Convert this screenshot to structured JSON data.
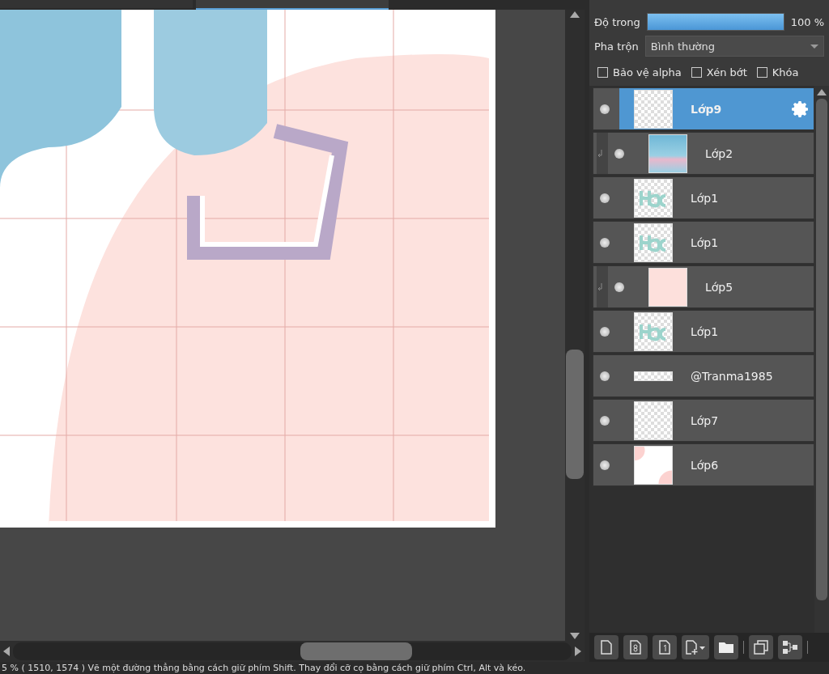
{
  "document_tabs": [
    {
      "selected": false
    },
    {
      "selected": true
    }
  ],
  "layer_panel": {
    "opacity": {
      "label": "Độ trong",
      "level": 1,
      "reading": "100 %"
    },
    "blend": {
      "label": "Pha trộn",
      "value": "Bình thường"
    },
    "options": [
      {
        "label": "Bảo vệ alpha",
        "checked": false
      },
      {
        "label": "Xén bớt",
        "checked": false
      },
      {
        "label": "Khóa",
        "checked": false
      }
    ],
    "layers": [
      {
        "name": "Lớp9",
        "kind": "normal",
        "thumbnail": {
          "kind": "transparent"
        },
        "selected": true,
        "visible": true
      },
      {
        "name": "Lớp2",
        "kind": "clipped",
        "thumbnail": {
          "kind": "blue"
        },
        "selected": false,
        "visible": true
      },
      {
        "name": "Lớp1",
        "kind": "normal",
        "thumbnail": {
          "kind": "lettering"
        },
        "selected": false,
        "visible": true
      },
      {
        "name": "Lớp1",
        "kind": "normal",
        "thumbnail": {
          "kind": "lettering"
        },
        "selected": false,
        "visible": true
      },
      {
        "name": "Lớp5",
        "kind": "clipped",
        "thumbnail": {
          "kind": "pink"
        },
        "selected": false,
        "visible": true
      },
      {
        "name": "Lớp1",
        "kind": "normal",
        "thumbnail": {
          "kind": "lettering"
        },
        "selected": false,
        "visible": true
      },
      {
        "name": "@Tranma1985",
        "kind": "normal",
        "thumbnail": {
          "kind": "strip"
        },
        "selected": false,
        "visible": true
      },
      {
        "name": "Lớp7",
        "kind": "normal",
        "thumbnail": {
          "kind": "transparent"
        },
        "selected": false,
        "visible": true
      },
      {
        "name": "Lớp6",
        "kind": "normal",
        "thumbnail": {
          "kind": "pink-dots"
        },
        "selected": false,
        "visible": true
      }
    ]
  },
  "status_bar": {
    "text": "5 %   ( 1510, 1574 )   Vẽ một đường thẳng bằng cách giữ phím Shift. Thay đổi cỡ cọ bằng cách giữ phím Ctrl, Alt và kéo."
  }
}
